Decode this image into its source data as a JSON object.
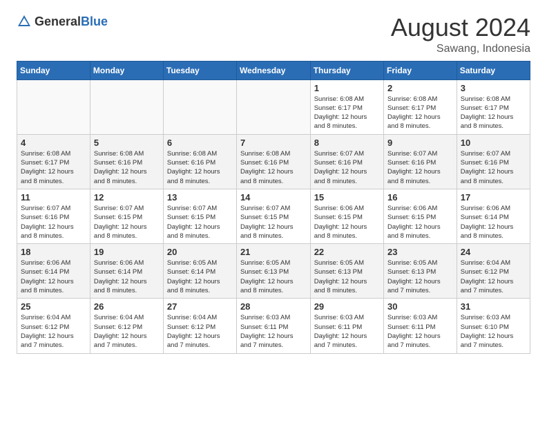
{
  "header": {
    "logo_general": "General",
    "logo_blue": "Blue",
    "month_year": "August 2024",
    "location": "Sawang, Indonesia"
  },
  "weekdays": [
    "Sunday",
    "Monday",
    "Tuesday",
    "Wednesday",
    "Thursday",
    "Friday",
    "Saturday"
  ],
  "weeks": [
    [
      {
        "day": "",
        "info": ""
      },
      {
        "day": "",
        "info": ""
      },
      {
        "day": "",
        "info": ""
      },
      {
        "day": "",
        "info": ""
      },
      {
        "day": "1",
        "info": "Sunrise: 6:08 AM\nSunset: 6:17 PM\nDaylight: 12 hours\nand 8 minutes."
      },
      {
        "day": "2",
        "info": "Sunrise: 6:08 AM\nSunset: 6:17 PM\nDaylight: 12 hours\nand 8 minutes."
      },
      {
        "day": "3",
        "info": "Sunrise: 6:08 AM\nSunset: 6:17 PM\nDaylight: 12 hours\nand 8 minutes."
      }
    ],
    [
      {
        "day": "4",
        "info": "Sunrise: 6:08 AM\nSunset: 6:17 PM\nDaylight: 12 hours\nand 8 minutes."
      },
      {
        "day": "5",
        "info": "Sunrise: 6:08 AM\nSunset: 6:16 PM\nDaylight: 12 hours\nand 8 minutes."
      },
      {
        "day": "6",
        "info": "Sunrise: 6:08 AM\nSunset: 6:16 PM\nDaylight: 12 hours\nand 8 minutes."
      },
      {
        "day": "7",
        "info": "Sunrise: 6:08 AM\nSunset: 6:16 PM\nDaylight: 12 hours\nand 8 minutes."
      },
      {
        "day": "8",
        "info": "Sunrise: 6:07 AM\nSunset: 6:16 PM\nDaylight: 12 hours\nand 8 minutes."
      },
      {
        "day": "9",
        "info": "Sunrise: 6:07 AM\nSunset: 6:16 PM\nDaylight: 12 hours\nand 8 minutes."
      },
      {
        "day": "10",
        "info": "Sunrise: 6:07 AM\nSunset: 6:16 PM\nDaylight: 12 hours\nand 8 minutes."
      }
    ],
    [
      {
        "day": "11",
        "info": "Sunrise: 6:07 AM\nSunset: 6:16 PM\nDaylight: 12 hours\nand 8 minutes."
      },
      {
        "day": "12",
        "info": "Sunrise: 6:07 AM\nSunset: 6:15 PM\nDaylight: 12 hours\nand 8 minutes."
      },
      {
        "day": "13",
        "info": "Sunrise: 6:07 AM\nSunset: 6:15 PM\nDaylight: 12 hours\nand 8 minutes."
      },
      {
        "day": "14",
        "info": "Sunrise: 6:07 AM\nSunset: 6:15 PM\nDaylight: 12 hours\nand 8 minutes."
      },
      {
        "day": "15",
        "info": "Sunrise: 6:06 AM\nSunset: 6:15 PM\nDaylight: 12 hours\nand 8 minutes."
      },
      {
        "day": "16",
        "info": "Sunrise: 6:06 AM\nSunset: 6:15 PM\nDaylight: 12 hours\nand 8 minutes."
      },
      {
        "day": "17",
        "info": "Sunrise: 6:06 AM\nSunset: 6:14 PM\nDaylight: 12 hours\nand 8 minutes."
      }
    ],
    [
      {
        "day": "18",
        "info": "Sunrise: 6:06 AM\nSunset: 6:14 PM\nDaylight: 12 hours\nand 8 minutes."
      },
      {
        "day": "19",
        "info": "Sunrise: 6:06 AM\nSunset: 6:14 PM\nDaylight: 12 hours\nand 8 minutes."
      },
      {
        "day": "20",
        "info": "Sunrise: 6:05 AM\nSunset: 6:14 PM\nDaylight: 12 hours\nand 8 minutes."
      },
      {
        "day": "21",
        "info": "Sunrise: 6:05 AM\nSunset: 6:13 PM\nDaylight: 12 hours\nand 8 minutes."
      },
      {
        "day": "22",
        "info": "Sunrise: 6:05 AM\nSunset: 6:13 PM\nDaylight: 12 hours\nand 8 minutes."
      },
      {
        "day": "23",
        "info": "Sunrise: 6:05 AM\nSunset: 6:13 PM\nDaylight: 12 hours\nand 7 minutes."
      },
      {
        "day": "24",
        "info": "Sunrise: 6:04 AM\nSunset: 6:12 PM\nDaylight: 12 hours\nand 7 minutes."
      }
    ],
    [
      {
        "day": "25",
        "info": "Sunrise: 6:04 AM\nSunset: 6:12 PM\nDaylight: 12 hours\nand 7 minutes."
      },
      {
        "day": "26",
        "info": "Sunrise: 6:04 AM\nSunset: 6:12 PM\nDaylight: 12 hours\nand 7 minutes."
      },
      {
        "day": "27",
        "info": "Sunrise: 6:04 AM\nSunset: 6:12 PM\nDaylight: 12 hours\nand 7 minutes."
      },
      {
        "day": "28",
        "info": "Sunrise: 6:03 AM\nSunset: 6:11 PM\nDaylight: 12 hours\nand 7 minutes."
      },
      {
        "day": "29",
        "info": "Sunrise: 6:03 AM\nSunset: 6:11 PM\nDaylight: 12 hours\nand 7 minutes."
      },
      {
        "day": "30",
        "info": "Sunrise: 6:03 AM\nSunset: 6:11 PM\nDaylight: 12 hours\nand 7 minutes."
      },
      {
        "day": "31",
        "info": "Sunrise: 6:03 AM\nSunset: 6:10 PM\nDaylight: 12 hours\nand 7 minutes."
      }
    ]
  ]
}
